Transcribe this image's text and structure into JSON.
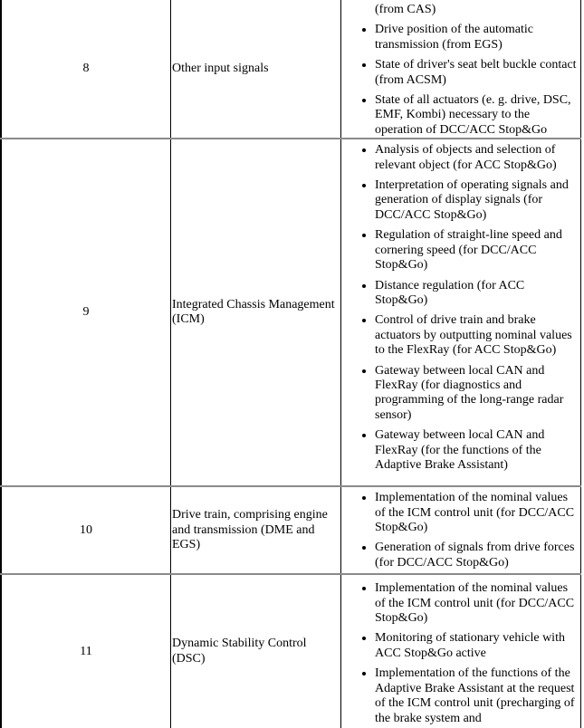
{
  "rows": [
    {
      "number": "8",
      "name": "Other input signals",
      "continuation": "(from CAS)",
      "items": [
        "Drive position of the automatic transmission (from EGS)",
        "State of driver's seat belt buckle contact (from ACSM)",
        "State of all actuators (e. g. drive, DSC, EMF, Kombi) necessary to the operation of DCC/ACC Stop&Go"
      ]
    },
    {
      "number": "9",
      "name": "Integrated Chassis Management (ICM)",
      "items": [
        "Analysis of objects and selection of relevant object (for ACC Stop&Go)",
        "Interpretation of operating signals and generation of display signals (for DCC/ACC Stop&Go)",
        "Regulation of straight-line speed and cornering speed (for DCC/ACC Stop&Go)",
        "Distance regulation (for ACC Stop&Go)",
        "Control of drive train and brake actuators by outputting nominal values to the FlexRay (for ACC Stop&Go)",
        "Gateway between local CAN and FlexRay (for diagnostics and programming of the long-range radar sensor)",
        "Gateway between local CAN and FlexRay (for the functions of the Adaptive Brake Assistant)"
      ]
    },
    {
      "number": "10",
      "name": "Drive train, comprising engine and transmission (DME and EGS)",
      "items": [
        "Implementation of the nominal values of the ICM control unit (for DCC/ACC Stop&Go)",
        "Generation of signals from drive forces (for DCC/ACC Stop&Go)"
      ]
    },
    {
      "number": "11",
      "name": "Dynamic Stability Control (DSC)",
      "items": [
        "Implementation of the nominal values of the ICM control unit (for DCC/ACC Stop&Go)",
        "Monitoring of stationary vehicle with ACC Stop&Go active",
        "Implementation of the functions of the Adaptive Brake Assistant at the request of the ICM control unit (precharging of the brake system and"
      ]
    }
  ]
}
